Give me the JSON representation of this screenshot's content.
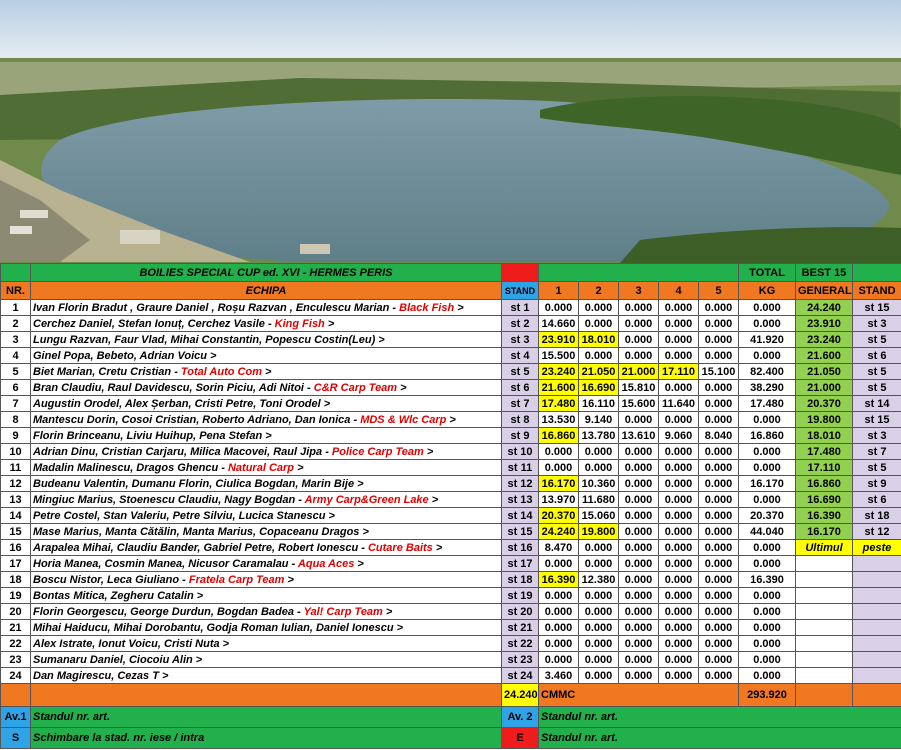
{
  "header": {
    "title": "BOILIES SPECIAL CUP ed. XVI - HERMES PERIS",
    "total_label": "TOTAL",
    "best_label": "BEST 15",
    "col_nr": "NR.",
    "col_echipa": "ECHIPA",
    "col_stand": "STAND",
    "rounds": [
      "1",
      "2",
      "3",
      "4",
      "5"
    ],
    "col_kg": "KG",
    "col_general": "GENERAL",
    "col_stand2": "STAND"
  },
  "rows": [
    {
      "nr": "1",
      "names": "Ivan Florin Bradut , Graure Daniel , Roșu Razvan , Enculescu Marian - ",
      "team": "Black Fish",
      "arrow": " >",
      "stand": "st 1",
      "r": [
        "0.000",
        "0.000",
        "0.000",
        "0.000",
        "0.000"
      ],
      "hl": [
        0,
        0,
        0,
        0,
        0
      ],
      "kg": "0.000",
      "general": "24.240",
      "stand2": "st 15"
    },
    {
      "nr": "2",
      "names": "Cerchez Daniel, Stefan Ionuț, Cerchez Vasile - ",
      "team": "King Fish",
      "arrow": " >",
      "stand": "st 2",
      "r": [
        "14.660",
        "0.000",
        "0.000",
        "0.000",
        "0.000"
      ],
      "hl": [
        0,
        0,
        0,
        0,
        0
      ],
      "kg": "0.000",
      "general": "23.910",
      "stand2": "st 3"
    },
    {
      "nr": "3",
      "names": "Lungu Razvan, Faur Vlad, Mihai Constantin, Popescu Costin(Leu)  >",
      "team": "",
      "arrow": "",
      "stand": "st 3",
      "r": [
        "23.910",
        "18.010",
        "0.000",
        "0.000",
        "0.000"
      ],
      "hl": [
        1,
        1,
        0,
        0,
        0
      ],
      "kg": "41.920",
      "general": "23.240",
      "stand2": "st 5"
    },
    {
      "nr": "4",
      "names": "Ginel Popa, Bebeto, Adrian Voicu  >",
      "team": "",
      "arrow": "",
      "stand": "st 4",
      "r": [
        "15.500",
        "0.000",
        "0.000",
        "0.000",
        "0.000"
      ],
      "hl": [
        0,
        0,
        0,
        0,
        0
      ],
      "kg": "0.000",
      "general": "21.600",
      "stand2": "st 6"
    },
    {
      "nr": "5",
      "names": "Biet Marian, Cretu Cristian - ",
      "team": "Total Auto Com",
      "arrow": " >",
      "stand": "st 5",
      "r": [
        "23.240",
        "21.050",
        "21.000",
        "17.110",
        "15.100"
      ],
      "hl": [
        1,
        1,
        1,
        1,
        0
      ],
      "kg": "82.400",
      "general": "21.050",
      "stand2": "st 5"
    },
    {
      "nr": "6",
      "names": "Bran Claudiu, Raul Davidescu, Sorin Piciu, Adi Nitoi - ",
      "team": "C&R Carp Team",
      "arrow": " >",
      "stand": "st 6",
      "r": [
        "21.600",
        "16.690",
        "15.810",
        "0.000",
        "0.000"
      ],
      "hl": [
        1,
        1,
        0,
        0,
        0
      ],
      "kg": "38.290",
      "general": "21.000",
      "stand2": "st 5"
    },
    {
      "nr": "7",
      "names": "Augustin Orodel, Alex Șerban, Cristi Petre, Toni Orodel  >",
      "team": "",
      "arrow": "",
      "stand": "st 7",
      "r": [
        "17.480",
        "16.110",
        "15.600",
        "11.640",
        "0.000"
      ],
      "hl": [
        1,
        0,
        0,
        0,
        0
      ],
      "kg": "17.480",
      "general": "20.370",
      "stand2": "st 14"
    },
    {
      "nr": "8",
      "names": "Mantescu Dorin, Cosoi Cristian, Roberto Adriano, Dan Ionica - ",
      "team": "MDS & Wlc Carp",
      "arrow": " >",
      "stand": "st 8",
      "r": [
        "13.530",
        "9.140",
        "0.000",
        "0.000",
        "0.000"
      ],
      "hl": [
        0,
        0,
        0,
        0,
        0
      ],
      "kg": "0.000",
      "general": "19.800",
      "stand2": "st 15"
    },
    {
      "nr": "9",
      "names": "Florin Brinceanu, Liviu Huihup, Pena Stefan  >",
      "team": "",
      "arrow": "",
      "stand": "st 9",
      "r": [
        "16.860",
        "13.780",
        "13.610",
        "9.060",
        "8.040"
      ],
      "hl": [
        1,
        0,
        0,
        0,
        0
      ],
      "kg": "16.860",
      "general": "18.010",
      "stand2": "st 3"
    },
    {
      "nr": "10",
      "names": "Adrian Dinu, Cristian Carjaru, Milica Macovei, Raul Jipa - ",
      "team": "Police Carp Team",
      "arrow": " >",
      "stand": "st 10",
      "r": [
        "0.000",
        "0.000",
        "0.000",
        "0.000",
        "0.000"
      ],
      "hl": [
        0,
        0,
        0,
        0,
        0
      ],
      "kg": "0.000",
      "general": "17.480",
      "stand2": "st 7"
    },
    {
      "nr": "11",
      "names": "Madalin Malinescu, Dragos Ghencu - ",
      "team": "Natural Carp",
      "arrow": " >",
      "stand": "st 11",
      "r": [
        "0.000",
        "0.000",
        "0.000",
        "0.000",
        "0.000"
      ],
      "hl": [
        0,
        0,
        0,
        0,
        0
      ],
      "kg": "0.000",
      "general": "17.110",
      "stand2": "st 5"
    },
    {
      "nr": "12",
      "names": "Budeanu Valentin, Dumanu Florin, Ciulica Bogdan, Marin Bije  >",
      "team": "",
      "arrow": "",
      "stand": "st 12",
      "r": [
        "16.170",
        "10.360",
        "0.000",
        "0.000",
        "0.000"
      ],
      "hl": [
        1,
        0,
        0,
        0,
        0
      ],
      "kg": "16.170",
      "general": "16.860",
      "stand2": "st 9"
    },
    {
      "nr": "13",
      "names": "Mingiuc Marius, Stoenescu Claudiu, Nagy Bogdan - ",
      "team": "Army Carp&Green Lake",
      "arrow": " >",
      "stand": "st 13",
      "r": [
        "13.970",
        "11.680",
        "0.000",
        "0.000",
        "0.000"
      ],
      "hl": [
        0,
        0,
        0,
        0,
        0
      ],
      "kg": "0.000",
      "general": "16.690",
      "stand2": "st 6"
    },
    {
      "nr": "14",
      "names": "Petre Costel, Stan Valeriu, Petre Silviu, Lucica Stanescu  >",
      "team": "",
      "arrow": "",
      "stand": "st 14",
      "r": [
        "20.370",
        "15.060",
        "0.000",
        "0.000",
        "0.000"
      ],
      "hl": [
        1,
        0,
        0,
        0,
        0
      ],
      "kg": "20.370",
      "general": "16.390",
      "stand2": "st 18"
    },
    {
      "nr": "15",
      "names": "Mase Marius, Manta Cătălin, Manta Marius, Copaceanu Dragos  >",
      "team": "",
      "arrow": "",
      "stand": "st 15",
      "r": [
        "24.240",
        "19.800",
        "0.000",
        "0.000",
        "0.000"
      ],
      "hl": [
        1,
        1,
        0,
        0,
        0
      ],
      "kg": "44.040",
      "general": "16.170",
      "stand2": "st 12"
    },
    {
      "nr": "16",
      "names": "Arapalea Mihai, Claudiu Bander, Gabriel Petre, Robert Ionescu - ",
      "team": "Cutare Baits",
      "arrow": " >",
      "stand": "st 16",
      "r": [
        "8.470",
        "0.000",
        "0.000",
        "0.000",
        "0.000"
      ],
      "hl": [
        0,
        0,
        0,
        0,
        0
      ],
      "kg": "0.000",
      "general": "Ultimul",
      "stand2": "peste",
      "special": true
    },
    {
      "nr": "17",
      "names": "Horia Manea, Cosmin Manea, Nicusor Caramalau - ",
      "team": "Aqua Aces",
      "arrow": " >",
      "stand": "st 17",
      "r": [
        "0.000",
        "0.000",
        "0.000",
        "0.000",
        "0.000"
      ],
      "hl": [
        0,
        0,
        0,
        0,
        0
      ],
      "kg": "0.000",
      "general": "",
      "stand2": ""
    },
    {
      "nr": "18",
      "names": "Boscu Nistor, Leca Giuliano - ",
      "team": "Fratela Carp Team",
      "arrow": " >",
      "stand": "st 18",
      "r": [
        "16.390",
        "12.380",
        "0.000",
        "0.000",
        "0.000"
      ],
      "hl": [
        1,
        0,
        0,
        0,
        0
      ],
      "kg": "16.390",
      "general": "",
      "stand2": ""
    },
    {
      "nr": "19",
      "names": "Bontas Mitica,  Zegheru  Catalin  >",
      "team": "",
      "arrow": "",
      "stand": "st 19",
      "r": [
        "0.000",
        "0.000",
        "0.000",
        "0.000",
        "0.000"
      ],
      "hl": [
        0,
        0,
        0,
        0,
        0
      ],
      "kg": "0.000",
      "general": "",
      "stand2": ""
    },
    {
      "nr": "20",
      "names": "Florin Georgescu, George Durdun, Bogdan Badea - ",
      "team": "Yal! Carp Team",
      "arrow": " >",
      "stand": "st 20",
      "r": [
        "0.000",
        "0.000",
        "0.000",
        "0.000",
        "0.000"
      ],
      "hl": [
        0,
        0,
        0,
        0,
        0
      ],
      "kg": "0.000",
      "general": "",
      "stand2": ""
    },
    {
      "nr": "21",
      "names": "Mihai Haiducu, Mihai Dorobantu, Godja Roman Iulian, Daniel Ionescu  >",
      "team": "",
      "arrow": "",
      "stand": "st 21",
      "r": [
        "0.000",
        "0.000",
        "0.000",
        "0.000",
        "0.000"
      ],
      "hl": [
        0,
        0,
        0,
        0,
        0
      ],
      "kg": "0.000",
      "general": "",
      "stand2": ""
    },
    {
      "nr": "22",
      "names": "Alex Istrate, Ionut Voicu, Cristi Nuta  >",
      "team": "",
      "arrow": "",
      "stand": "st 22",
      "r": [
        "0.000",
        "0.000",
        "0.000",
        "0.000",
        "0.000"
      ],
      "hl": [
        0,
        0,
        0,
        0,
        0
      ],
      "kg": "0.000",
      "general": "",
      "stand2": ""
    },
    {
      "nr": "23",
      "names": "Sumanaru Daniel, Ciocoiu Alin  >",
      "team": "",
      "arrow": "",
      "stand": "st 23",
      "r": [
        "0.000",
        "0.000",
        "0.000",
        "0.000",
        "0.000"
      ],
      "hl": [
        0,
        0,
        0,
        0,
        0
      ],
      "kg": "0.000",
      "general": "",
      "stand2": ""
    },
    {
      "nr": "24",
      "names": "Dan Magirescu, Cezas T  >",
      "team": "",
      "arrow": "",
      "stand": "st 24",
      "r": [
        "3.460",
        "0.000",
        "0.000",
        "0.000",
        "0.000"
      ],
      "hl": [
        0,
        0,
        0,
        0,
        0
      ],
      "kg": "0.000",
      "general": "",
      "stand2": ""
    }
  ],
  "summary": {
    "best": "24.240",
    "label": "CMMC",
    "total": "293.920"
  },
  "footer": {
    "av1": "Av.1",
    "av1_text": "Standul nr.       art.",
    "av2": "Av. 2",
    "av2_text": "Standul  nr.       art.",
    "s": "S",
    "s_text": "Schimbare la stad.  nr.  iese  / intra",
    "e": "E",
    "e_text": "Standul  nr.       art."
  },
  "colors": {
    "green": "#22b04c",
    "orange": "#f07820",
    "red": "#ef1c1c",
    "yellow": "#ffff00",
    "light_green": "#92d050",
    "lavender": "#d9d0e8",
    "blue": "#2ea4e6"
  }
}
